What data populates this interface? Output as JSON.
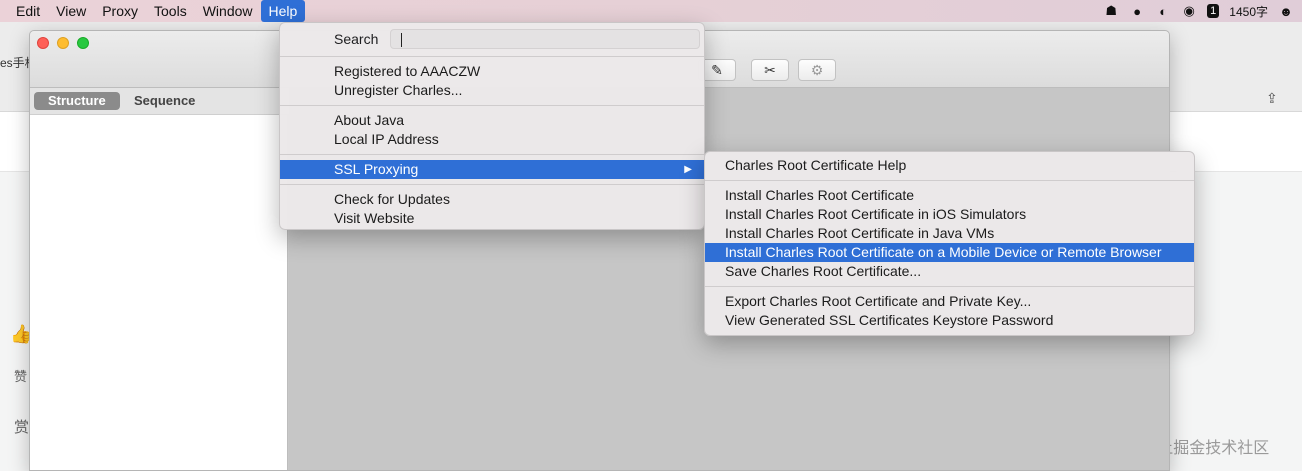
{
  "menubar": {
    "items": [
      "Edit",
      "View",
      "Proxy",
      "Tools",
      "Window",
      "Help"
    ],
    "active": "Help",
    "status": {
      "count_badge": "1",
      "word_count": "1450字"
    }
  },
  "background_page": {
    "tab_text": "es手机",
    "like_label": "赞",
    "reward_label": "赏",
    "watermark": "@稀土掘金技术社区"
  },
  "charles": {
    "tabs": [
      "Structure",
      "Sequence"
    ],
    "selected_tab": "Structure"
  },
  "help_menu": {
    "search_label": "Search",
    "search_value": "",
    "groups": [
      [
        "Registered to AAACZW",
        "Unregister Charles..."
      ],
      [
        "About Java",
        "Local IP Address"
      ],
      [
        "SSL Proxying"
      ],
      [
        "Check for Updates",
        "Visit Website"
      ]
    ],
    "highlighted": "SSL Proxying"
  },
  "ssl_submenu": {
    "groups": [
      [
        "Charles Root Certificate Help"
      ],
      [
        "Install Charles Root Certificate",
        "Install Charles Root Certificate in iOS Simulators",
        "Install Charles Root Certificate in Java VMs",
        "Install Charles Root Certificate on a Mobile Device or Remote Browser",
        "Save Charles Root Certificate..."
      ],
      [
        "Export Charles Root Certificate and Private Key...",
        "View Generated SSL Certificates Keystore Password"
      ]
    ],
    "highlighted": "Install Charles Root Certificate on a Mobile Device or Remote Browser"
  },
  "colors": {
    "highlight": "#2f6fd6",
    "menubar_bg": "#ebd2d8"
  }
}
